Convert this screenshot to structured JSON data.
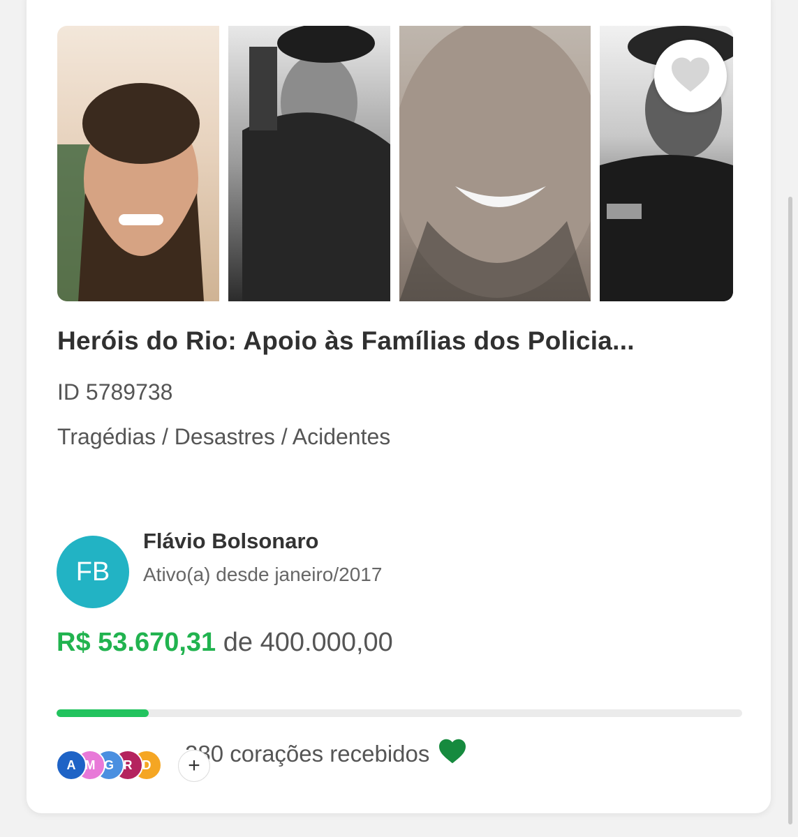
{
  "campaign": {
    "title": "Heróis do Rio: Apoio às Famílias dos Policia...",
    "id_text": "ID 5789738",
    "category": "Tragédias / Desastres / Acidentes"
  },
  "author": {
    "initials": "FB",
    "name": "Flávio Bolsonaro",
    "since": "Ativo(a) desde janeiro/2017"
  },
  "funding": {
    "raised": "R$ 53.670,31",
    "separator": "de",
    "goal": "400.000,00",
    "progress_fraction": 0.134
  },
  "supporters": {
    "avatars": [
      {
        "initial": "A",
        "color": "#1e63c6"
      },
      {
        "initial": "M",
        "color": "#e879d8"
      },
      {
        "initial": "G",
        "color": "#4a8fe0"
      },
      {
        "initial": "R",
        "color": "#b4235e"
      },
      {
        "initial": "D",
        "color": "#f5a623"
      }
    ],
    "more_symbol": "+",
    "hearts_label": "280 corações recebidos"
  },
  "icons": {
    "favorite": "heart-icon",
    "received": "green-heart-icon"
  },
  "colors": {
    "accent_green": "#21b34f",
    "avatar_teal": "#22b3c4"
  }
}
